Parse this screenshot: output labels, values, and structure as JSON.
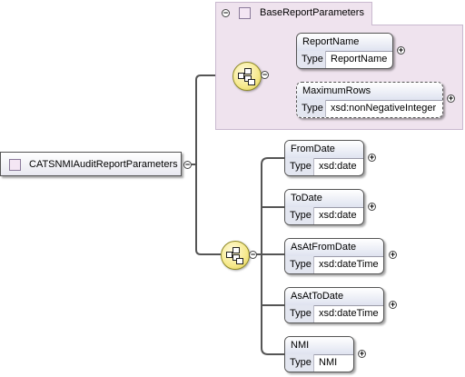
{
  "root_element": {
    "name": "CATSNMIAuditReportParameters",
    "toggle": "−"
  },
  "base_group": {
    "name": "BaseReportParameters",
    "toggle": "−",
    "sequence_toggle": "−",
    "elements": [
      {
        "name": "ReportName",
        "type_label": "Type",
        "type": "ReportName",
        "expand": "+"
      },
      {
        "name": "MaximumRows",
        "type_label": "Type",
        "type": "xsd:nonNegativeInteger",
        "expand": "+"
      }
    ]
  },
  "sequence": {
    "toggle": "−",
    "elements": [
      {
        "name": "FromDate",
        "type_label": "Type",
        "type": "xsd:date",
        "expand": "+"
      },
      {
        "name": "ToDate",
        "type_label": "Type",
        "type": "xsd:date",
        "expand": "+"
      },
      {
        "name": "AsAtFromDate",
        "type_label": "Type",
        "type": "xsd:dateTime",
        "expand": "+"
      },
      {
        "name": "AsAtToDate",
        "type_label": "Type",
        "type": "xsd:dateTime",
        "expand": "+"
      },
      {
        "name": "NMI",
        "type_label": "Type",
        "type": "NMI",
        "expand": "+"
      }
    ]
  },
  "colors": {
    "connector": "#555555",
    "group_fill": "#efe3ee",
    "sequence_fill": "#f6e98a"
  }
}
